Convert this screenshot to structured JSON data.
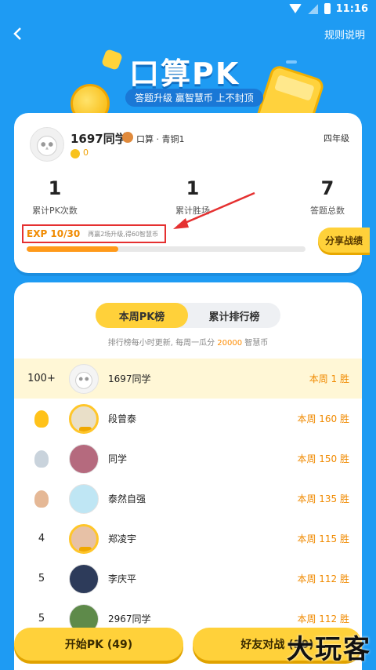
{
  "status_bar": {
    "time": "11:16"
  },
  "header": {
    "rules_label": "规则说明"
  },
  "banner": {
    "title": "口算PK",
    "subtitle": "答题升级 赢智慧币 上不封顶"
  },
  "profile": {
    "username": "1697同学",
    "rank": "口算 · 青铜1",
    "coins": "0",
    "grade": "四年级",
    "stats": [
      {
        "value": "1",
        "label": "累计PK次数"
      },
      {
        "value": "1",
        "label": "累计胜场"
      },
      {
        "value": "7",
        "label": "答题总数"
      }
    ],
    "exp_label": "EXP 10/30",
    "exp_hint": "再赢2场升级,得60智慧币",
    "exp_progress": 0.33,
    "share_label": "分享战绩"
  },
  "leaderboard": {
    "tabs": [
      {
        "label": "本周PK榜",
        "active": true
      },
      {
        "label": "累计排行榜",
        "active": false
      }
    ],
    "note_prefix": "排行榜每小时更新, 每周一瓜分",
    "note_amount": "20000",
    "note_suffix": "智慧币",
    "rows": [
      {
        "pos": "100+",
        "name": "1697同学",
        "wins": "本周 1 胜",
        "me": true
      },
      {
        "pos": "1",
        "name": "段曾泰",
        "wins": "本周 160 胜",
        "medal": "gold"
      },
      {
        "pos": "2",
        "name": "同学",
        "wins": "本周 150 胜",
        "medal": "silver"
      },
      {
        "pos": "3",
        "name": "泰然自强",
        "wins": "本周 135 胜",
        "medal": "bronze"
      },
      {
        "pos": "4",
        "name": "郑凌宇",
        "wins": "本周 115 胜"
      },
      {
        "pos": "5",
        "name": "李庆平",
        "wins": "本周 112 胜"
      },
      {
        "pos": "5",
        "name": "2967同学",
        "wins": "本周 112 胜"
      }
    ]
  },
  "actions": {
    "start_label": "开始PK (49)",
    "friend_label": "好友对战 (30)"
  },
  "watermark": "大玩客",
  "colors": {
    "background": "#1e9bf3",
    "accent": "#ffd13a",
    "exp": "#ff9a1a",
    "highlight_border": "#e53030"
  }
}
